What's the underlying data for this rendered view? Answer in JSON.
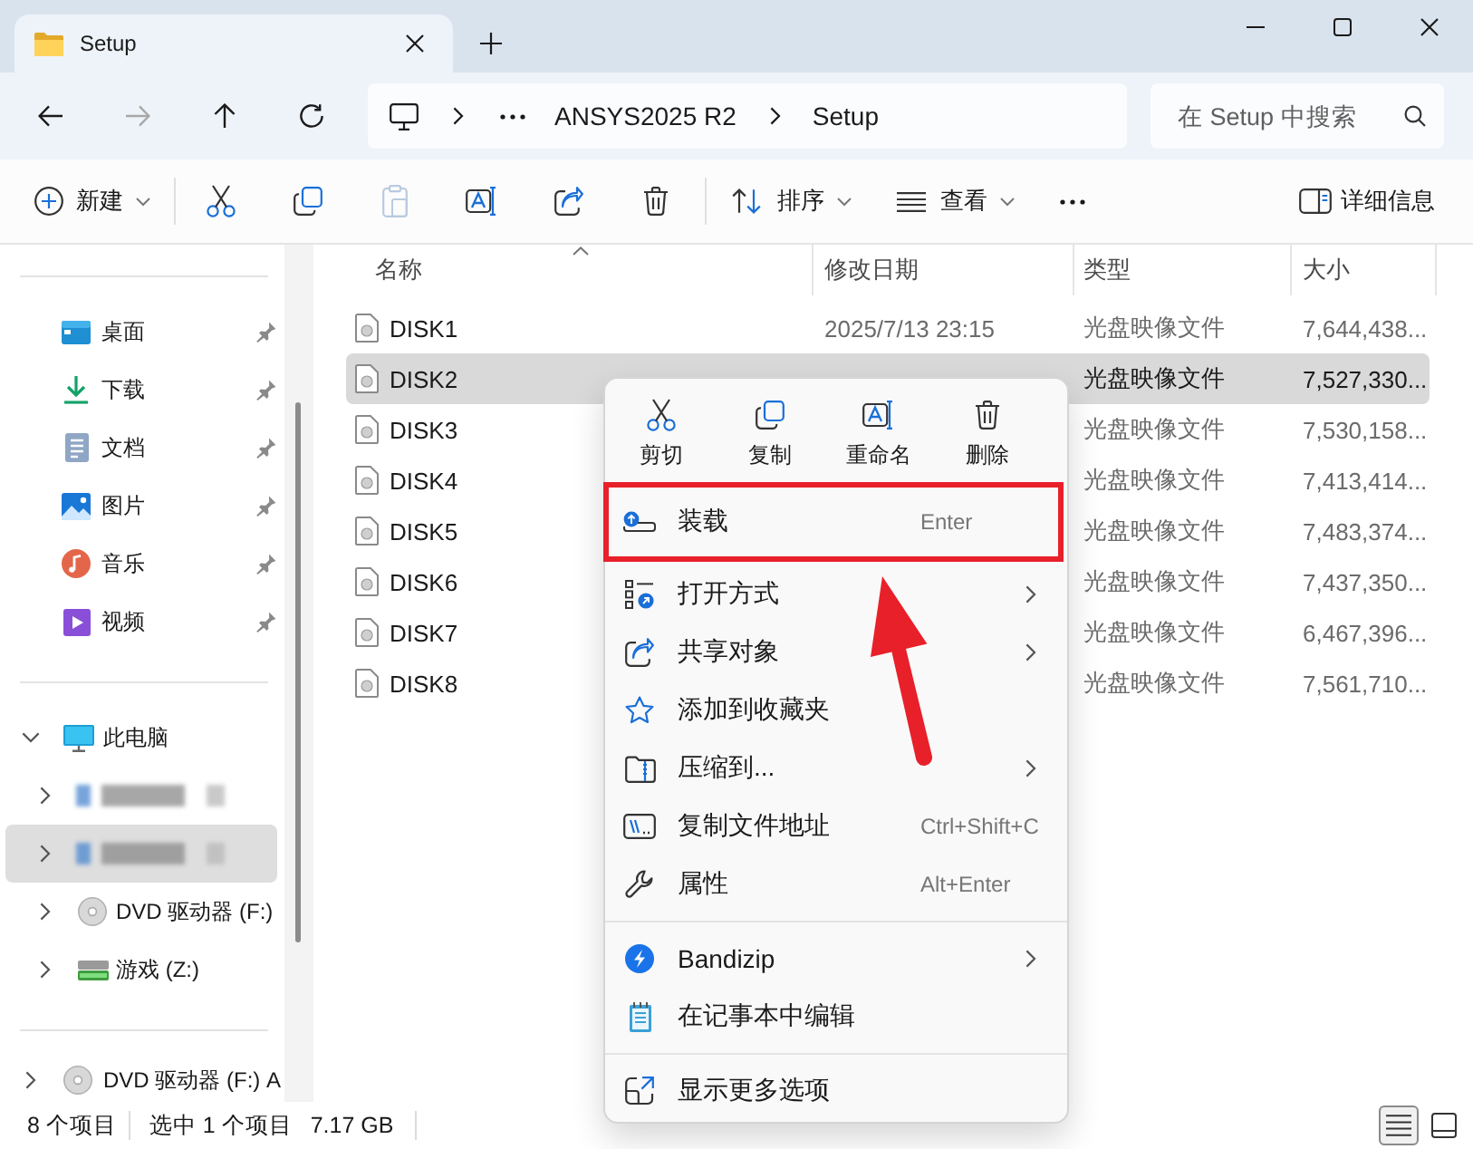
{
  "window": {
    "tab_title": "Setup"
  },
  "navigation": {
    "back_disabled": false,
    "forward_disabled": true
  },
  "address_bar": {
    "segments": [
      "ANSYS2025 R2",
      "Setup"
    ]
  },
  "search": {
    "placeholder": "在 Setup 中搜索"
  },
  "toolbar": {
    "new_label": "新建",
    "actions": [
      {
        "kind": "cut",
        "disabled": false
      },
      {
        "kind": "copy",
        "disabled": false
      },
      {
        "kind": "paste",
        "disabled": true
      },
      {
        "kind": "rename",
        "disabled": false
      },
      {
        "kind": "share",
        "disabled": false
      },
      {
        "kind": "delete",
        "disabled": false
      }
    ],
    "sort_label": "排序",
    "view_label": "查看",
    "details_label": "详细信息"
  },
  "sidebar": {
    "quick_access": [
      {
        "kind": "desktop",
        "label": "桌面",
        "pinned": true
      },
      {
        "kind": "download",
        "label": "下载",
        "pinned": true
      },
      {
        "kind": "documents",
        "label": "文档",
        "pinned": true
      },
      {
        "kind": "pictures",
        "label": "图片",
        "pinned": true
      },
      {
        "kind": "music",
        "label": "音乐",
        "pinned": true
      },
      {
        "kind": "videos",
        "label": "视频",
        "pinned": true
      }
    ],
    "this_pc": {
      "label": "此电脑",
      "expanded": true,
      "children": [
        {
          "kind": "redacted",
          "selected": false
        },
        {
          "kind": "redacted",
          "selected": true
        },
        {
          "kind": "dvd",
          "label": "DVD 驱动器 (F:)",
          "selected": false
        },
        {
          "kind": "drive",
          "label": "游戏 (Z:)",
          "selected": false
        }
      ]
    },
    "more": [
      {
        "kind": "dvd",
        "label": "DVD 驱动器 (F:) A",
        "expanded": false
      }
    ]
  },
  "file_list": {
    "columns": [
      {
        "label": "名称",
        "sorted": true
      },
      {
        "label": "修改日期",
        "sorted": false
      },
      {
        "label": "类型",
        "sorted": false
      },
      {
        "label": "大小",
        "sorted": false
      }
    ],
    "rows": [
      {
        "name": "DISK1",
        "modified": "2025/7/13 23:15",
        "type": "光盘映像文件",
        "size": "7,644,438...",
        "selected": false
      },
      {
        "name": "DISK2",
        "type": "光盘映像文件",
        "size": "7,527,330...",
        "selected": true
      },
      {
        "name": "DISK3",
        "type": "光盘映像文件",
        "size": "7,530,158...",
        "selected": false
      },
      {
        "name": "DISK4",
        "type": "光盘映像文件",
        "size": "7,413,414...",
        "selected": false
      },
      {
        "name": "DISK5",
        "type": "光盘映像文件",
        "size": "7,483,374...",
        "selected": false
      },
      {
        "name": "DISK6",
        "type": "光盘映像文件",
        "size": "7,437,350...",
        "selected": false
      },
      {
        "name": "DISK7",
        "type": "光盘映像文件",
        "size": "6,467,396...",
        "selected": false
      },
      {
        "name": "DISK8",
        "type": "光盘映像文件",
        "size": "7,561,710...",
        "selected": false
      }
    ]
  },
  "context_menu": {
    "quick_actions": [
      {
        "kind": "cut",
        "label": "剪切"
      },
      {
        "kind": "copy",
        "label": "复制"
      },
      {
        "kind": "rename",
        "label": "重命名"
      },
      {
        "kind": "delete",
        "label": "删除"
      }
    ],
    "groups": [
      {
        "items": [
          {
            "kind": "mount",
            "label": "装载",
            "shortcut": "Enter",
            "submenu": false,
            "highlighted": true
          },
          {
            "kind": "open-with",
            "label": "打开方式",
            "submenu": true,
            "highlighted": false
          },
          {
            "kind": "share",
            "label": "共享对象",
            "submenu": true,
            "highlighted": false
          },
          {
            "kind": "favorite",
            "label": "添加到收藏夹",
            "submenu": false,
            "highlighted": false
          },
          {
            "kind": "compress",
            "label": "压缩到...",
            "submenu": true,
            "highlighted": false
          },
          {
            "kind": "copy-path",
            "label": "复制文件地址",
            "shortcut": "Ctrl+Shift+C",
            "submenu": false,
            "highlighted": false
          },
          {
            "kind": "properties",
            "label": "属性",
            "shortcut": "Alt+Enter",
            "submenu": false,
            "highlighted": false
          }
        ]
      },
      {
        "items": [
          {
            "kind": "bandizip",
            "label": "Bandizip",
            "submenu": true,
            "highlighted": false
          },
          {
            "kind": "notepad",
            "label": "在记事本中编辑",
            "submenu": false,
            "highlighted": false
          }
        ]
      },
      {
        "items": [
          {
            "kind": "more-options",
            "label": "显示更多选项",
            "submenu": false,
            "highlighted": false
          }
        ]
      }
    ]
  },
  "annotations": [
    {
      "kind": "arrow"
    }
  ],
  "status_bar": {
    "item_count": "8 个项目",
    "selection": "选中 1 个项目",
    "selection_size": "7.17 GB",
    "view_modes": [
      {
        "kind": "details",
        "selected": true
      },
      {
        "kind": "tiles",
        "selected": false
      }
    ]
  }
}
